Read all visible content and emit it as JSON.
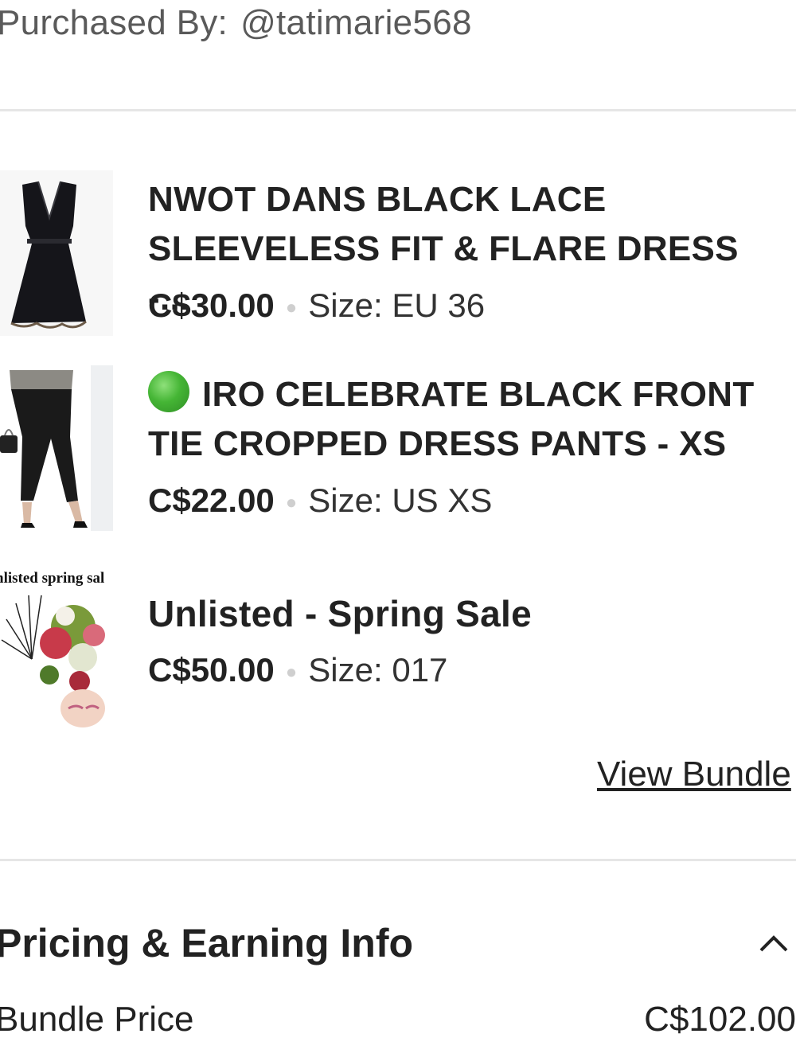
{
  "purchased_by": {
    "label": "Purchased By:",
    "handle": "@tatimarie568"
  },
  "items": [
    {
      "title": "NWOT DANS BLACK LACE SLEEVELESS FIT & FLARE DRESS -...",
      "price": "C$30.00",
      "size_label": "Size:",
      "size_value": "EU 36",
      "thumbnail": "black-lace-dress-image"
    },
    {
      "title": "IRO CELEBRATE BLACK FRONT TIE CROPPED DRESS PANTS - XS",
      "title_prefix_icon": "green-circle-icon",
      "price": "C$22.00",
      "size_label": "Size:",
      "size_value": "US XS",
      "thumbnail": "black-pants-image"
    },
    {
      "title": "Unlisted - Spring Sale",
      "price": "C$50.00",
      "size_label": "Size:",
      "size_value": "017",
      "thumbnail": "spring-sale-floral-image",
      "thumbnail_caption": "nlisted spring sal"
    }
  ],
  "view_bundle_label": "View Bundle",
  "pricing_section": {
    "title": "Pricing & Earning Info",
    "toggle_icon": "chevron-up-icon",
    "rows": [
      {
        "label": "Bundle Price",
        "value": "C$102.00"
      }
    ]
  },
  "colors": {
    "text": "#222222",
    "muted": "#5a5a5a",
    "divider": "#e6e6e6",
    "green_dot": "#45b535"
  }
}
